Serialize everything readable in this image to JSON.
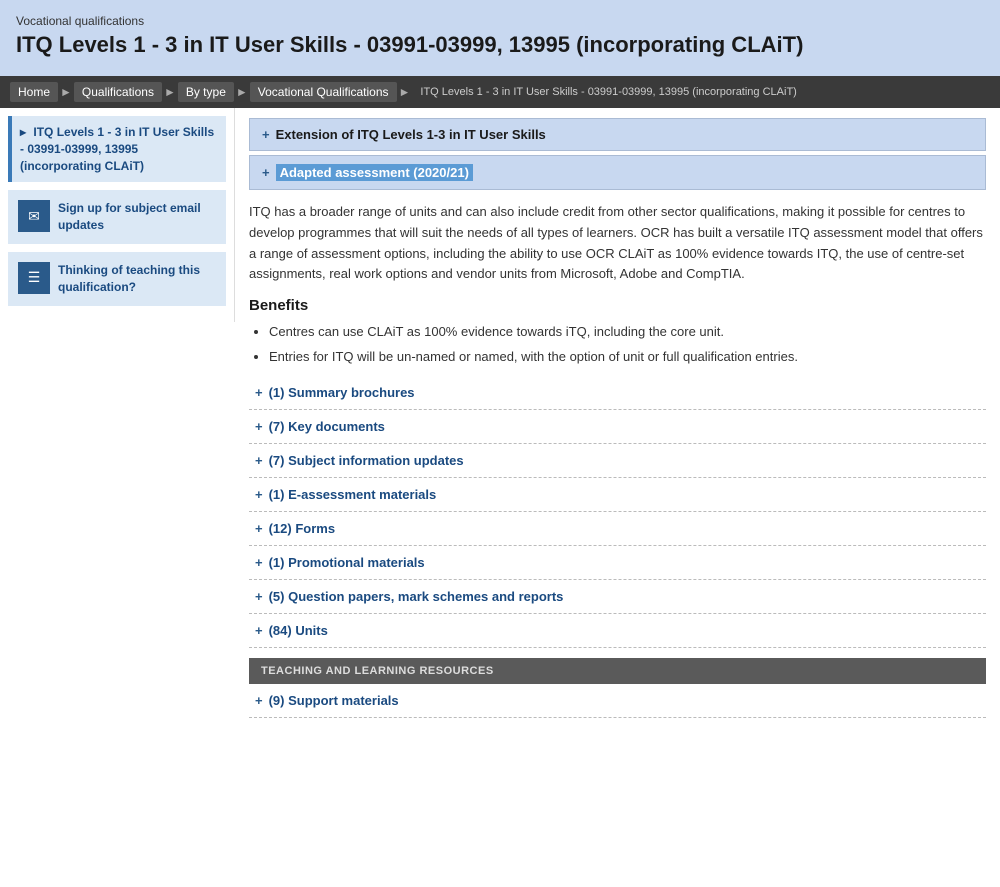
{
  "header": {
    "subtitle": "Vocational qualifications",
    "title": "ITQ Levels 1 - 3 in IT User Skills - 03991-03999, 13995 (incorporating CLAiT)"
  },
  "breadcrumb": {
    "items": [
      {
        "label": "Home",
        "active": false
      },
      {
        "label": "Qualifications",
        "active": false
      },
      {
        "label": "By type",
        "active": false
      },
      {
        "label": "Vocational Qualifications",
        "active": false
      },
      {
        "label": "ITQ Levels 1 - 3 in IT User Skills - 03991-03999, 13995 (incorporating CLAiT)",
        "active": true
      }
    ]
  },
  "sidebar": {
    "nav_item": {
      "label": "ITQ Levels 1 - 3 in IT User Skills - 03991-03999, 13995 (incorporating CLAiT)"
    },
    "card1": {
      "icon": "✉",
      "label": "Sign up for subject email updates"
    },
    "card2": {
      "icon": "☰",
      "label": "Thinking of teaching this qualification?"
    }
  },
  "main": {
    "section1_title": "Extension of ITQ Levels 1-3 in IT User Skills",
    "section2_title": "Adapted assessment (2020/21)",
    "description": "ITQ has a broader range of units and can also include credit from other sector qualifications, making it possible for centres to develop programmes that will suit the needs of all types of learners. OCR has built a versatile ITQ assessment model that offers a range of assessment options, including the ability to use OCR CLAiT as 100% evidence towards ITQ, the use of centre-set assignments, real work options and vendor units from Microsoft, Adobe and CompTIA.",
    "benefits_title": "Benefits",
    "benefits": [
      "Centres can use CLAiT as 100% evidence towards iTQ, including the core unit.",
      "Entries for ITQ will be un-named or named, with the option of unit or full qualification entries."
    ],
    "collapsible_rows": [
      {
        "count": "(1)",
        "label": "Summary brochures"
      },
      {
        "count": "(7)",
        "label": "Key documents"
      },
      {
        "count": "(7)",
        "label": "Subject information updates"
      },
      {
        "count": "(1)",
        "label": "E-assessment materials"
      },
      {
        "count": "(12)",
        "label": "Forms"
      },
      {
        "count": "(1)",
        "label": "Promotional materials"
      },
      {
        "count": "(5)",
        "label": "Question papers, mark schemes and reports"
      },
      {
        "count": "(84)",
        "label": "Units"
      }
    ],
    "resources_bar": "TEACHING AND LEARNING RESOURCES",
    "support_row": {
      "count": "(9)",
      "label": "Support materials"
    }
  }
}
